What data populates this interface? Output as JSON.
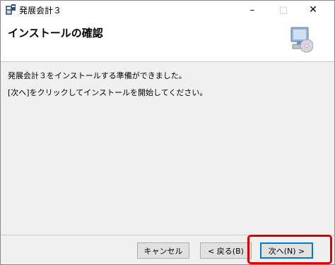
{
  "window": {
    "title": "発展会計３",
    "minimize_glyph": "–",
    "maximize_glyph": "□",
    "close_glyph": "✕"
  },
  "header": {
    "title": "インストールの確認",
    "icon": "computer-cd-icon"
  },
  "messages": {
    "line1": "発展会計３をインストールする準備ができました。",
    "line2": "[次へ]をクリックしてインストールを開始してください。"
  },
  "buttons": {
    "cancel": "キャンセル",
    "back": "< 戻る(B)",
    "next": "次へ(N) >"
  },
  "colors": {
    "highlight": "#e00000",
    "default_button_border": "#0078d7"
  }
}
